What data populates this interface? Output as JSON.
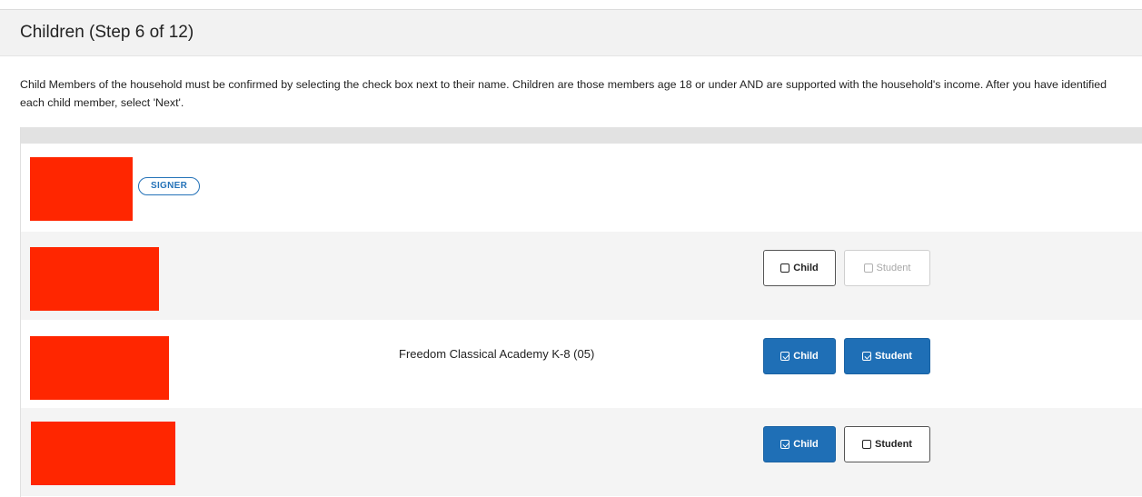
{
  "header": {
    "title": "Children  (Step 6 of 12)"
  },
  "instructions": "Child Members of the household must be confirmed by selecting the check box next to their name. Children are those members age 18 or under AND are supported with the household's income. After you have identified each child member, select 'Next'.",
  "members": [
    {
      "badge": "SIGNER"
    },
    {
      "child_label": "Child",
      "child_checked": false,
      "student_label": "Student",
      "student_checked": false,
      "student_enabled": false
    },
    {
      "school": "Freedom Classical Academy K-8 (05)",
      "child_label": "Child",
      "child_checked": true,
      "student_label": "Student",
      "student_checked": true,
      "student_enabled": true
    },
    {
      "child_label": "Child",
      "child_checked": true,
      "student_label": "Student",
      "student_checked": false,
      "student_enabled": true
    }
  ],
  "colors": {
    "accent": "#1f6fb6",
    "redaction": "#ff2600",
    "header_bg": "#f2f2f2",
    "row_alt": "#f4f4f4"
  }
}
